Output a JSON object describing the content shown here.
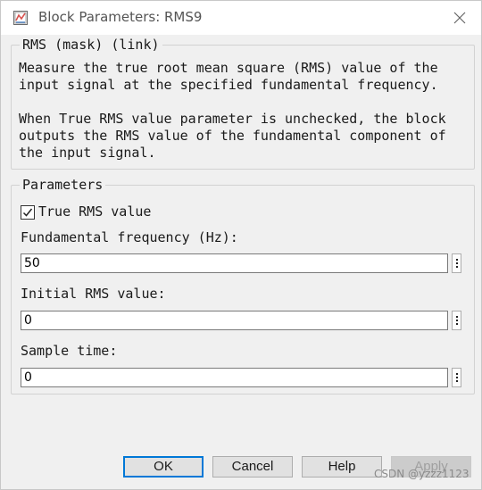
{
  "window": {
    "title": "Block Parameters: RMS9",
    "icons": {
      "app": "simulink-block-icon",
      "close": "close-icon"
    }
  },
  "description": {
    "legend": "RMS (mask) (link)",
    "paragraph_1": "Measure the true root mean square (RMS) value of the input signal at the specified fundamental frequency.",
    "paragraph_2": "When True RMS value parameter is unchecked, the block outputs the RMS value of the fundamental component of the input signal."
  },
  "parameters": {
    "legend": "Parameters",
    "true_rms": {
      "label": "True RMS value",
      "checked": true
    },
    "fundamental_frequency": {
      "label": "Fundamental frequency (Hz):",
      "value": "50"
    },
    "initial_rms": {
      "label": "Initial RMS value:",
      "value": "0"
    },
    "sample_time": {
      "label": "Sample time:",
      "value": "0"
    },
    "more_options_icon": "vertical-ellipsis-icon"
  },
  "buttons": {
    "ok": "OK",
    "cancel": "Cancel",
    "help": "Help",
    "apply": "Apply"
  },
  "watermark": "CSDN @yzzz1123",
  "colors": {
    "title_bar": "#ffffff",
    "dialog_bg": "#f0f0f0",
    "focus_border": "#0078d7",
    "disabled_text": "#a0a0a0"
  }
}
